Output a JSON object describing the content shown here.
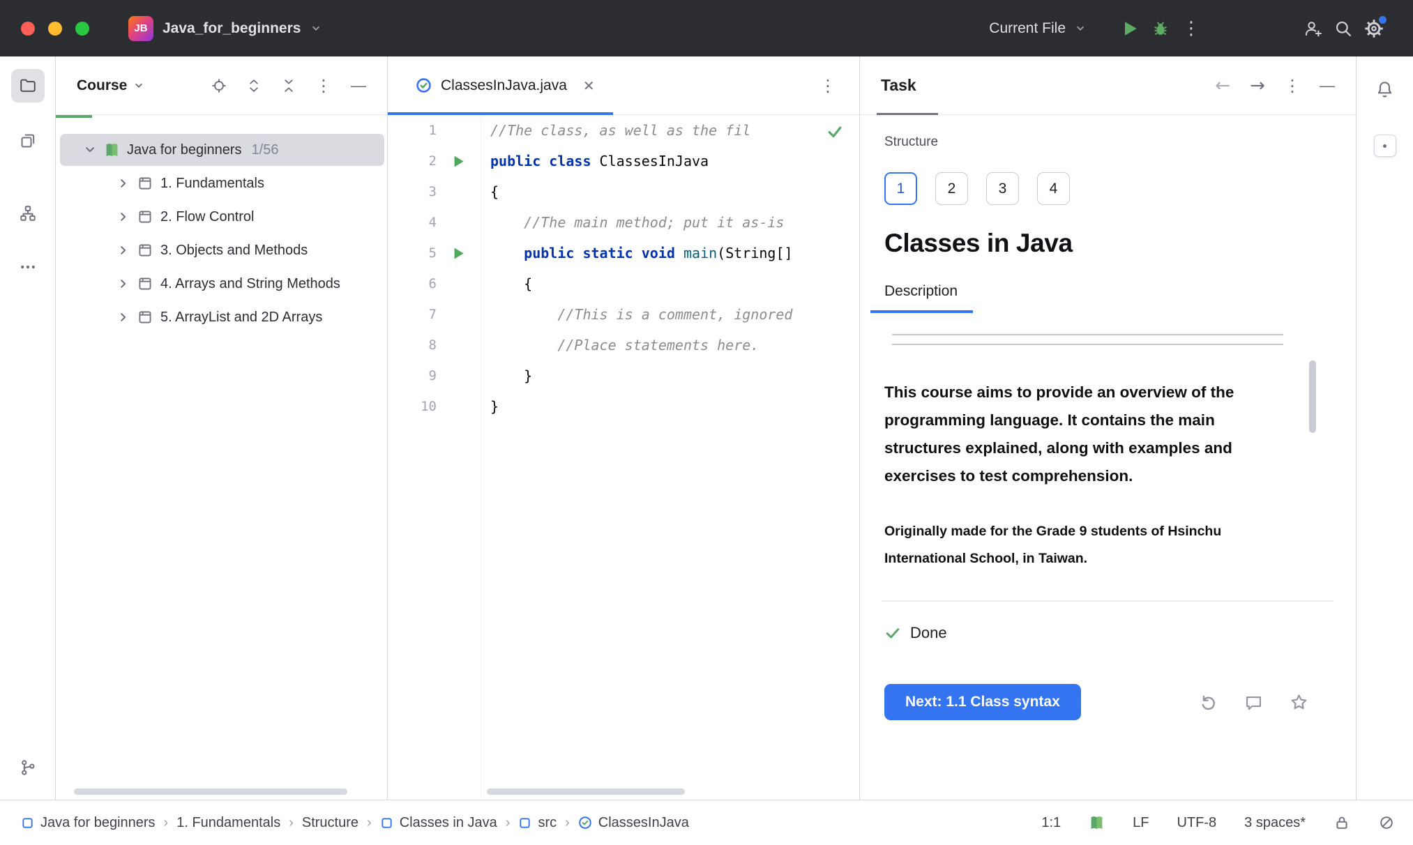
{
  "colors": {
    "accent_blue": "#3574F0",
    "run_green": "#59A869",
    "selection_gray": "#D9DBE0",
    "keyword_blue": "#0033B3",
    "comment_gray": "#8C8C8C",
    "titlebar_bg": "#2B2D30"
  },
  "titlebar": {
    "logo": "JB",
    "project": "Java_for_beginners",
    "run_config": "Current File",
    "icons": [
      "run-icon",
      "debug-icon",
      "more-icon",
      "add-user-icon",
      "search-icon",
      "settings-icon"
    ]
  },
  "activity_bar": {
    "icons": [
      "folder-icon",
      "copies-icon",
      "structure-icon",
      "more-icon",
      "git-branch-icon"
    ]
  },
  "course_panel": {
    "title": "Course",
    "header_icons": [
      "locate-icon",
      "expand-all-icon",
      "collapse-all-icon",
      "more-icon",
      "hide-icon"
    ],
    "progress_fraction": "1/56",
    "tree": [
      {
        "label": "Java for beginners",
        "count": "1/56",
        "level": 0,
        "expanded": true,
        "selected": true,
        "icon": "book"
      },
      {
        "label": "1. Fundamentals",
        "level": 1,
        "expanded": false,
        "icon": "lesson"
      },
      {
        "label": "2. Flow Control",
        "level": 1,
        "expanded": false,
        "icon": "lesson"
      },
      {
        "label": "3. Objects and Methods",
        "level": 1,
        "expanded": false,
        "icon": "lesson"
      },
      {
        "label": "4. Arrays and String Methods",
        "level": 1,
        "expanded": false,
        "icon": "lesson"
      },
      {
        "label": "5. ArrayList and 2D Arrays",
        "level": 1,
        "expanded": false,
        "icon": "lesson"
      }
    ]
  },
  "editor": {
    "tab": "ClassesInJava.java",
    "inspection_status": "ok",
    "lines": [
      {
        "num": "1",
        "tokens": [
          {
            "c": "comment",
            "t": "//The class, as well as the fil"
          }
        ]
      },
      {
        "num": "2",
        "run": true,
        "tokens": [
          {
            "c": "kw",
            "t": "public"
          },
          {
            "t": " "
          },
          {
            "c": "kw",
            "t": "class"
          },
          {
            "t": " ClassesInJava"
          }
        ]
      },
      {
        "num": "3",
        "tokens": [
          {
            "t": "{"
          }
        ]
      },
      {
        "num": "4",
        "tokens": [
          {
            "c": "comment",
            "t": "    //The main method; put it as-is"
          }
        ]
      },
      {
        "num": "5",
        "run": true,
        "tokens": [
          {
            "t": "    "
          },
          {
            "c": "kw",
            "t": "public"
          },
          {
            "t": " "
          },
          {
            "c": "kw",
            "t": "static"
          },
          {
            "t": " "
          },
          {
            "c": "kw",
            "t": "void"
          },
          {
            "t": " "
          },
          {
            "c": "method",
            "t": "main"
          },
          {
            "t": "(String[]"
          }
        ]
      },
      {
        "num": "6",
        "tokens": [
          {
            "t": "    {"
          }
        ]
      },
      {
        "num": "7",
        "tokens": [
          {
            "c": "comment",
            "t": "        //This is a comment, ignored"
          }
        ]
      },
      {
        "num": "8",
        "tokens": [
          {
            "c": "comment",
            "t": "        //Place statements here."
          }
        ]
      },
      {
        "num": "9",
        "tokens": [
          {
            "t": "    }"
          }
        ]
      },
      {
        "num": "10",
        "tokens": [
          {
            "t": "}"
          }
        ]
      }
    ]
  },
  "task_panel": {
    "title": "Task",
    "header_icons": [
      "back-icon",
      "forward-icon",
      "more-icon",
      "hide-icon"
    ],
    "section_label": "Structure",
    "steps": [
      "1",
      "2",
      "3",
      "4"
    ],
    "active_step_index": 0,
    "heading": "Classes in Java",
    "tab_label": "Description",
    "body_paragraph": "This course aims to provide an overview of the programming language. It contains the main structures explained, along with examples and exercises to test comprehension.",
    "body_note": "Originally made for the Grade 9 students of Hsinchu International School, in Taiwan.",
    "done_label": "Done",
    "next_button_label": "Next: 1.1 Class syntax",
    "action_icons": [
      "reset-icon",
      "comment-icon",
      "star-icon"
    ]
  },
  "rightbar": {
    "icons": [
      "bell-icon",
      "tool-window-stripe-button"
    ]
  },
  "statusbar": {
    "breadcrumbs": [
      {
        "label": "Java for beginners",
        "icon": "module"
      },
      {
        "label": "1. Fundamentals",
        "icon": null
      },
      {
        "label": "Structure",
        "icon": null
      },
      {
        "label": "Classes in Java",
        "icon": "module"
      },
      {
        "label": "src",
        "icon": "module"
      },
      {
        "label": "ClassesInJava",
        "icon": "class"
      }
    ],
    "caret": "1:1",
    "line_separator": "LF",
    "encoding": "UTF-8",
    "indent_style": "3 spaces*"
  }
}
